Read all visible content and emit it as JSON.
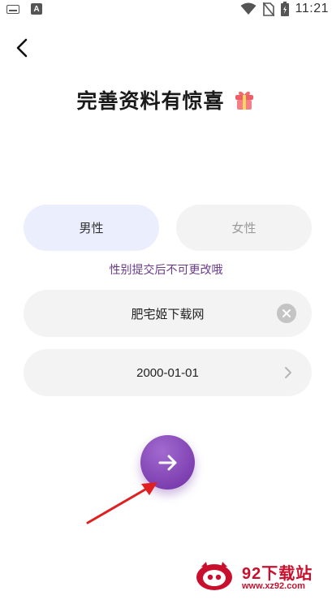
{
  "status_bar": {
    "time": "11:21",
    "left_icons": [
      "keyboard-icon",
      "a-text-icon"
    ],
    "right_icons": [
      "wifi-icon",
      "no-sim-icon",
      "battery-icon"
    ]
  },
  "header": {
    "back_icon": "chevron-left-icon",
    "title": "完善资料有惊喜",
    "title_icon": "gift-icon"
  },
  "gender": {
    "male_label": "男性",
    "female_label": "女性",
    "selected": "male",
    "hint": "性别提交后不可更改哦"
  },
  "form": {
    "nickname_value": "肥宅姬下载网",
    "nickname_clear_icon": "close-icon",
    "birthday_value": "2000-01-01",
    "birthday_chevron_icon": "chevron-right-icon"
  },
  "actions": {
    "next_icon": "arrow-right-icon"
  },
  "watermark": {
    "brand": "92下载站",
    "url": "www.xz92.com"
  },
  "colors": {
    "accent_purple": "#7b3aae",
    "male_selected_bg": "#ebeefd",
    "field_bg": "#f3f3f3",
    "hint_text": "#6a3a8a",
    "annotation_red": "#e02020",
    "watermark_red": "#c8102e"
  }
}
